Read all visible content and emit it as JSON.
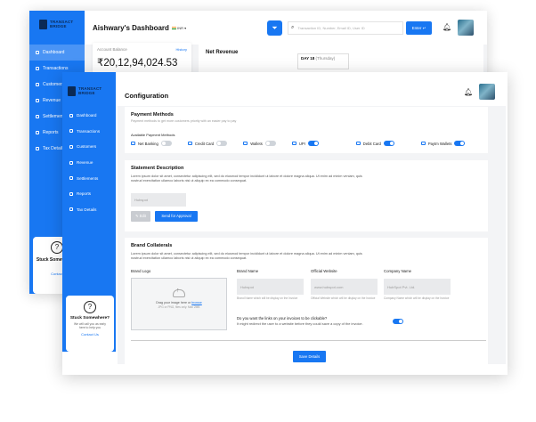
{
  "brand": {
    "line1": "TRANSACT",
    "line2": "BRIDGE"
  },
  "colors": {
    "primary": "#1877f2",
    "navy": "#0b2a55",
    "toggle_off": "#cfd4da"
  },
  "dashboard": {
    "title": "Aishwary's Dashboard",
    "currency": "INR",
    "search_placeholder": "Transaction ID, Number, Email ID, User ID",
    "enter_label": "Enter",
    "nav": [
      "Dashboard",
      "Transactions",
      "Customers",
      "Revenue",
      "Settlements",
      "Reports",
      "Tax Details"
    ],
    "account_balance_label": "Account Balance",
    "account_balance_link": "History",
    "account_balance_value": "₹20,12,94,024.53",
    "net_revenue_title": "Net Revenue",
    "tooltip_day": "DAY 18",
    "tooltip_weekday": "(Thursday)",
    "help_title": "Stuck Somewhere?",
    "help_link": "Contact"
  },
  "config": {
    "title": "Configuration",
    "nav": [
      "Dashboard",
      "Transactions",
      "Customers",
      "Revenue",
      "Settlements",
      "Reports",
      "Tax Details"
    ],
    "help": {
      "title": "Stuck Somewhere?",
      "desc_line1": "We will call you as early",
      "desc_line2": "here to help you",
      "link": "Contact Us"
    },
    "payment": {
      "title": "Payment Methods",
      "subtitle": "Payment methods to get more customers priority with an easier pay to pay",
      "available_label": "Available Payment Methods",
      "methods": [
        {
          "label": "Net Banking",
          "on": false
        },
        {
          "label": "Credit Card",
          "on": false
        },
        {
          "label": "Wallets",
          "on": false
        },
        {
          "label": "UPI",
          "on": true
        },
        {
          "label": "Debit Card",
          "on": true
        },
        {
          "label": "Paytm Wallets",
          "on": true
        }
      ]
    },
    "statement": {
      "title": "Statement Description",
      "text": "Lorem ipsum dolor sit amet, consectetur adipiscing elit, sed do eiusmod tempor incididunt ut labore et dolore magna aliqua. Ut enim ad minim veniam, quis nostrud exercitation ullamco laboris nisi ut aliquip ex ea commodo consequat.",
      "input_value": "Hubspot",
      "edit_label": "Edit",
      "send_label": "Send for Approval"
    },
    "collaterals": {
      "title": "Brand Collaterals",
      "text": "Lorem ipsum dolor sit amet, consectetur adipiscing elit, sed do eiusmod tempor incididunt ut labore et dolore magna aliqua. Ut enim ad minim veniam, quis nostrud exercitation ullamco laboris nisi ut aliquip ex ea commodo consequat.",
      "logo_label": "Brand Logo",
      "upload_text": "Drag your image here or",
      "upload_link": "browse",
      "upload_hint": "JPG or PNG, files only. Max 2MB",
      "brand_name_label": "Brand Name",
      "brand_name_value": "Hubspot",
      "brand_name_hint": "Brand Name which will be display on the Invoice",
      "website_label": "Official Website",
      "website_value": "www.hubspot.com",
      "website_hint": "Official Website which will be display on the Invoice",
      "company_label": "Company Name",
      "company_value": "HubSpot Pvt. Ltd.",
      "company_hint": "Company Name which will be display on the Invoice",
      "clickable_q": "Do you want the links on your invoices to be clickable?",
      "clickable_hint": "It might redirect the user to a website before they could save a copy of the invoice.",
      "clickable_on": true
    },
    "save_label": "Save Details"
  }
}
